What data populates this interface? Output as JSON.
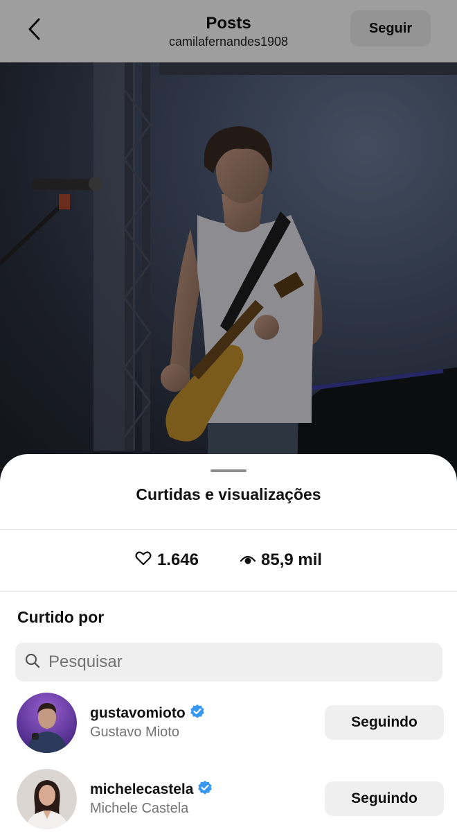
{
  "header": {
    "title": "Posts",
    "username": "camilafernandes1908",
    "follow_label": "Seguir"
  },
  "sheet": {
    "title": "Curtidas e visualizações",
    "likes": "1.646",
    "views": "85,9 mil",
    "liked_by_title": "Curtido por",
    "search_placeholder": "Pesquisar"
  },
  "users": [
    {
      "username": "gustavomioto",
      "name": "Gustavo Mioto",
      "verified": true,
      "button": "Seguindo"
    },
    {
      "username": "michelecastela",
      "name": "Michele Castela",
      "verified": true,
      "button": "Seguindo"
    }
  ],
  "colors": {
    "verified": "#3897f0",
    "button_bg": "#efefef",
    "secondary_text": "#737373"
  }
}
